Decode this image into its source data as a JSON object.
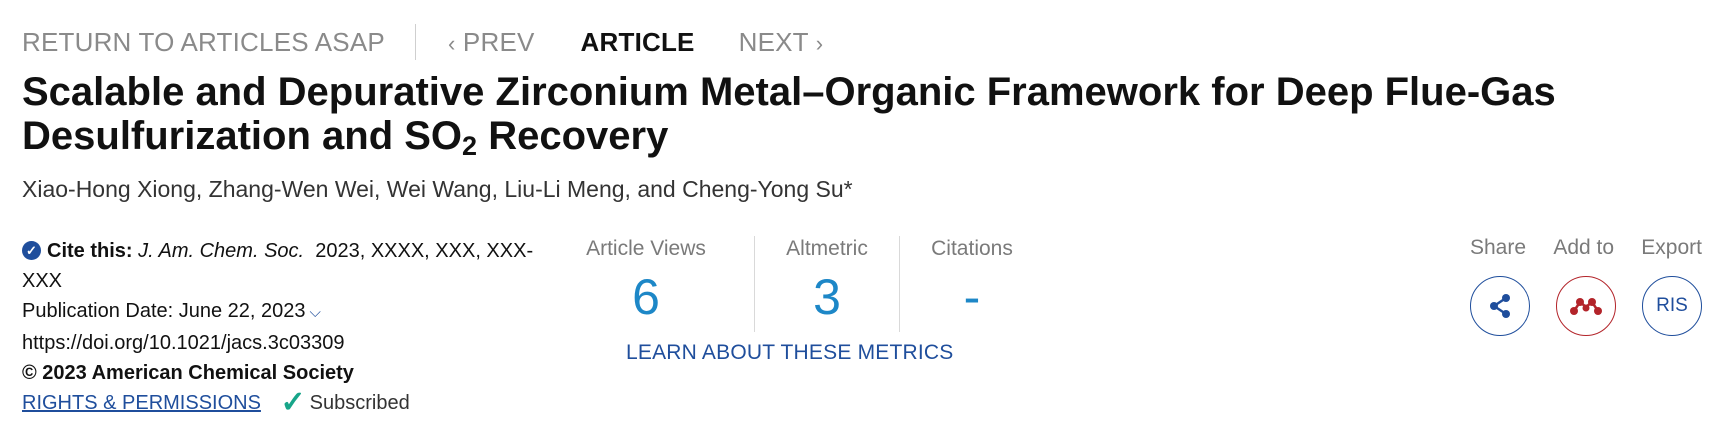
{
  "nav": {
    "return_label": "RETURN TO ARTICLES ASAP",
    "prev_label": "PREV",
    "current_label": "ARTICLE",
    "next_label": "NEXT"
  },
  "article": {
    "title_part1": "Scalable and Depurative Zirconium Metal–Organic Framework for Deep Flue-Gas Desulfurization and SO",
    "title_sub": "2",
    "title_part2": " Recovery",
    "authors": "Xiao-Hong Xiong, Zhang-Wen Wei, Wei Wang, Liu-Li Meng, and Cheng-Yong Su*"
  },
  "cite": {
    "label": "Cite this:",
    "journal": "J. Am. Chem. Soc.",
    "details": "2023, XXXX, XXX, XXX-XXX",
    "publication_date": "Publication Date: June 22, 2023",
    "doi": "https://doi.org/10.1021/jacs.3c03309",
    "copyright": "© 2023 American Chemical Society",
    "rights_label": "RIGHTS & PERMISSIONS",
    "subscribed_label": "Subscribed"
  },
  "metrics": {
    "views_label": "Article Views",
    "views_value": "6",
    "altmetric_label": "Altmetric",
    "altmetric_value": "3",
    "citations_label": "Citations",
    "citations_value": "-",
    "learn_label": "LEARN ABOUT THESE METRICS"
  },
  "actions": {
    "share_label": "Share",
    "add_label": "Add to",
    "export_label": "Export",
    "ris_label": "RIS",
    "share_icon": "share-icon",
    "add_icon": "mendeley-icon"
  },
  "colors": {
    "accent_blue": "#1f4e9c",
    "metric_blue": "#1d87c7",
    "mendeley_red": "#b3242a",
    "subscribed_green": "#17a589"
  }
}
